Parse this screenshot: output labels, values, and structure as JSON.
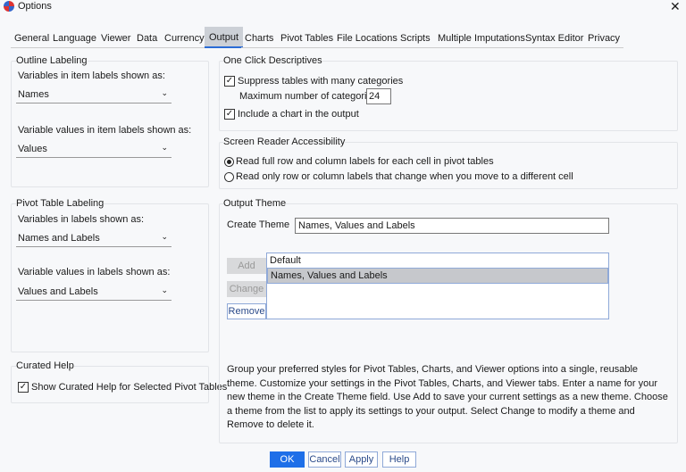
{
  "window": {
    "title": "Options",
    "close": "✕"
  },
  "tabs": [
    "General",
    "Language",
    "Viewer",
    "Data",
    "Currency",
    "Output",
    "Charts",
    "Pivot Tables",
    "File Locations",
    "Scripts",
    "Multiple Imputations",
    "Syntax Editor",
    "Privacy"
  ],
  "selected_tab": "Output",
  "outline": {
    "title": "Outline Labeling",
    "var_label": "Variables in item labels shown as:",
    "var_value": "Names",
    "val_label": "Variable values in item labels shown as:",
    "val_value": "Values"
  },
  "pivot": {
    "title": "Pivot Table Labeling",
    "var_label": "Variables in labels shown as:",
    "var_value": "Names and Labels",
    "val_label": "Variable values in labels shown as:",
    "val_value": "Values and Labels"
  },
  "curated": {
    "title": "Curated Help",
    "checkbox": "Show Curated Help for Selected Pivot Tables",
    "checked": true
  },
  "one_click": {
    "title": "One Click Descriptives",
    "suppress": "Suppress tables with many categories",
    "suppress_checked": true,
    "max_label": "Maximum number of categories:",
    "max_value": "24",
    "chart": "Include a chart in the output",
    "chart_checked": true
  },
  "screen_reader": {
    "title": "Screen Reader Accessibility",
    "opt1": "Read full row and column labels for each cell in pivot tables",
    "opt2": "Read only row or column labels that change when you move to a different cell",
    "selected": 1
  },
  "theme": {
    "title": "Output Theme",
    "create_label": "Create Theme",
    "create_value": "Names, Values and Labels",
    "add": "Add",
    "change": "Change",
    "remove": "Remove",
    "list": [
      "Default",
      "Names, Values and Labels"
    ],
    "selected": "Names, Values and Labels",
    "description": "Group your preferred styles for Pivot Tables, Charts, and Viewer options into a single, reusable theme. Customize your settings in the Pivot Tables, Charts, and Viewer tabs. Enter a name for your new theme in the Create Theme field. Use Add to save your current settings as a new theme. Choose a theme from the list to apply its settings to your output. Select Change to modify a theme and Remove to delete it."
  },
  "buttons": {
    "ok": "OK",
    "cancel": "Cancel",
    "apply": "Apply",
    "help": "Help"
  },
  "check": "✓",
  "chev": "⌄"
}
